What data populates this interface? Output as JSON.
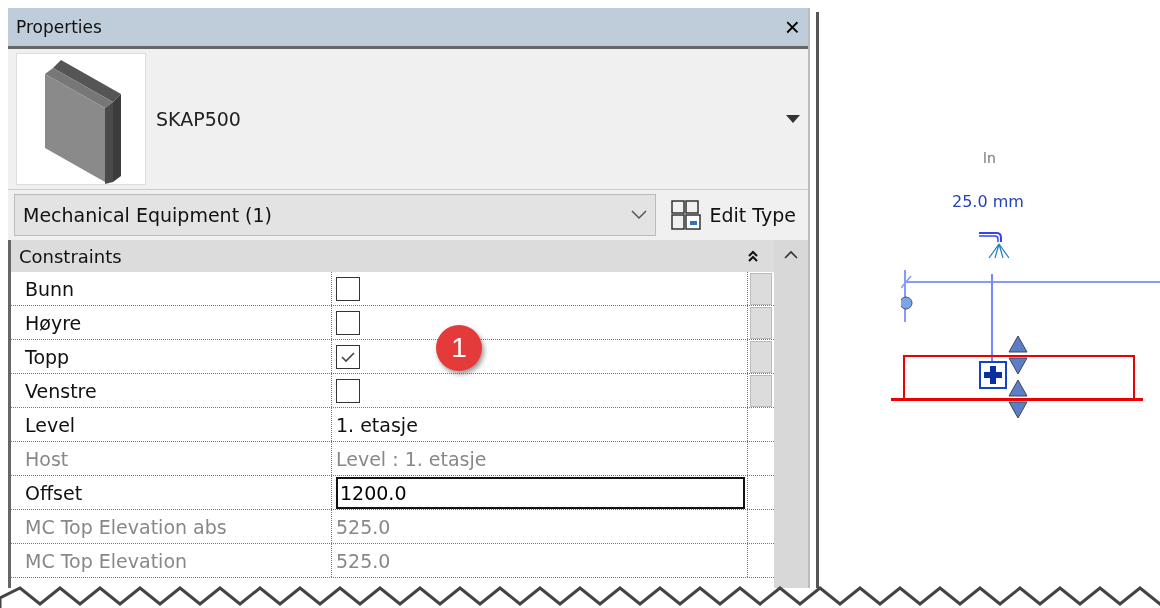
{
  "panel": {
    "title": "Properties",
    "close": "×"
  },
  "type_selector": {
    "name": "SKAP500"
  },
  "category": {
    "value": "Mechanical Equipment (1)",
    "edit_type": "Edit Type"
  },
  "group": {
    "title": "Constraints",
    "expanded": true
  },
  "rows": [
    {
      "label": "Bunn",
      "kind": "checkbox",
      "checked": false,
      "disabled": false
    },
    {
      "label": "Høyre",
      "kind": "checkbox",
      "checked": false,
      "disabled": false
    },
    {
      "label": "Topp",
      "kind": "checkbox",
      "checked": true,
      "disabled": false
    },
    {
      "label": "Venstre",
      "kind": "checkbox",
      "checked": false,
      "disabled": false
    },
    {
      "label": "Level",
      "kind": "text",
      "value": "1. etasje",
      "disabled": false
    },
    {
      "label": "Host",
      "kind": "text",
      "value": "Level : 1. etasje",
      "disabled": true
    },
    {
      "label": "Offset",
      "kind": "input",
      "value": "1200.0",
      "disabled": false
    },
    {
      "label": "MC Top Elevation abs",
      "kind": "text",
      "value": "525.0",
      "disabled": true
    },
    {
      "label": "MC Top Elevation",
      "kind": "text",
      "value": "525.0",
      "disabled": true
    }
  ],
  "callout": {
    "number": "1"
  },
  "view": {
    "connector_label": "ln",
    "dimension": "25.0 mm"
  }
}
